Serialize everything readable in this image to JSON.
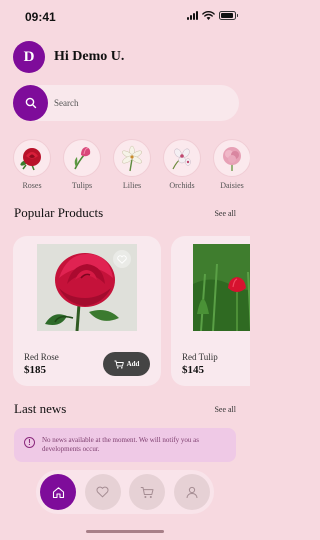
{
  "status_bar": {
    "time": "09:41",
    "battery_level": 0.9
  },
  "header": {
    "avatar_initial": "D",
    "greeting": "Hi Demo U."
  },
  "search": {
    "placeholder": "Search",
    "value": ""
  },
  "categories": [
    {
      "label": "Roses",
      "icon": "rose-flower-icon",
      "color": "#c2142b"
    },
    {
      "label": "Tulips",
      "icon": "tulip-flower-icon",
      "color": "#d9487a"
    },
    {
      "label": "Lilies",
      "icon": "lily-flower-icon",
      "color": "#f4f1e4"
    },
    {
      "label": "Orchids",
      "icon": "orchid-flower-icon",
      "color": "#f3eef4"
    },
    {
      "label": "Daisies",
      "icon": "daisy-flower-icon",
      "color": "#e7a1b6"
    }
  ],
  "popular": {
    "title": "Popular Products",
    "see_all": "See all"
  },
  "products": [
    {
      "name": "Red Rose",
      "price": "$185",
      "add_label": "Add"
    },
    {
      "name": "Red Tulip",
      "price": "$145"
    }
  ],
  "news": {
    "title": "Last news",
    "see_all": "See all",
    "message": "No news available at the moment. We will notify you as developments occur."
  },
  "nav": {
    "items": [
      "home-icon",
      "heart-icon",
      "cart-icon",
      "profile-icon"
    ],
    "active": "home-icon"
  },
  "colors": {
    "accent": "#7e0c9a",
    "background": "#f7d9e0",
    "add_button": "#444444"
  }
}
